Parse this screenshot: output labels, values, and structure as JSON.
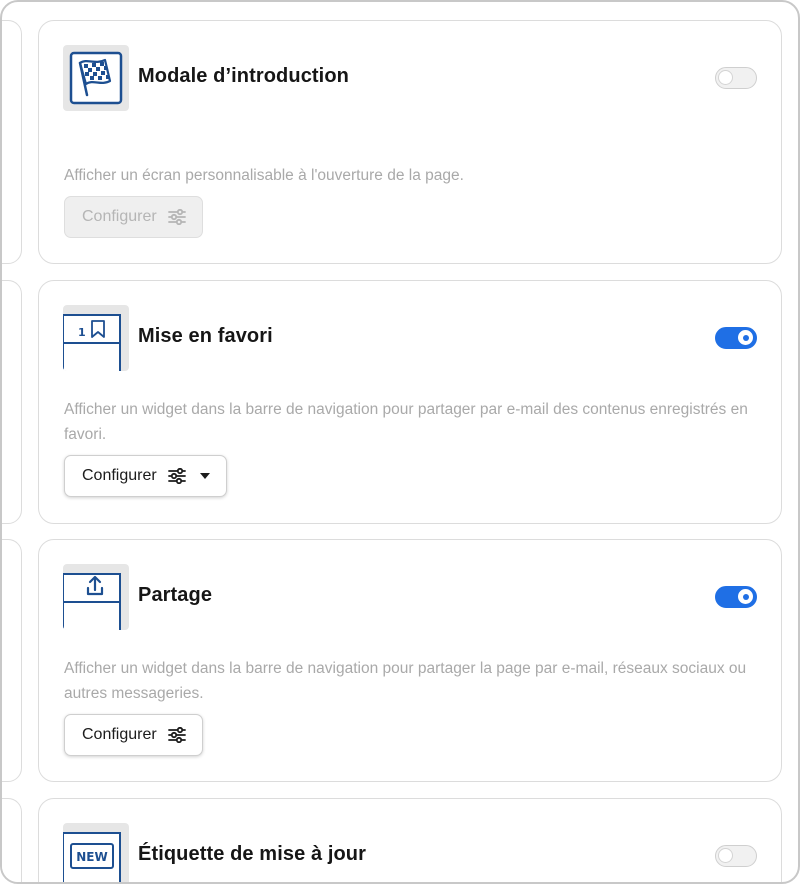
{
  "cards": [
    {
      "title": "Modale d’introduction",
      "description": "Afficher un écran personnalisable à l'ouverture de la page.",
      "button_label": "Configurer",
      "enabled": false,
      "button_disabled": true,
      "icon": "checkered-flag-icon"
    },
    {
      "title": "Mise en favori",
      "description": "Afficher un widget dans la barre de navigation pour partager par e-mail des contenus enregistrés en favori.",
      "button_label": "Configurer",
      "enabled": true,
      "button_disabled": false,
      "icon": "bookmark-icon",
      "thumb_number": "1"
    },
    {
      "title": "Partage",
      "description": "Afficher un widget dans la barre de navigation pour partager la page par e-mail, réseaux sociaux ou autres messageries.",
      "button_label": "Configurer",
      "enabled": true,
      "button_disabled": false,
      "icon": "share-upload-icon"
    },
    {
      "title": "Étiquette de mise à jour",
      "enabled": false,
      "icon": "new-label-icon",
      "thumb_label": "NEW"
    }
  ],
  "colors": {
    "accent": "#1f6fe5",
    "icon_blue": "#1d4f91",
    "muted_text": "#a9a9a9"
  }
}
